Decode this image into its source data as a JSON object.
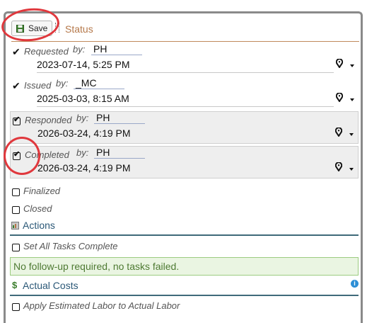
{
  "toolbar": {
    "save_label": "Save",
    "title": "Status"
  },
  "statuses": [
    {
      "label": "Requested",
      "by_label": "by:",
      "by_value": "PH",
      "datetime": "2023-07-14, 5:25 PM",
      "checked": true
    },
    {
      "label": "Issued",
      "by_label": "by:",
      "by_value": "_MC",
      "datetime": "2025-03-03, 8:15 AM",
      "checked": true
    },
    {
      "label": "Responded",
      "by_label": "by:",
      "by_value": "PH",
      "datetime": "2026-03-24, 4:19 PM",
      "checked": true
    },
    {
      "label": "Completed",
      "by_label": "by:",
      "by_value": "PH",
      "datetime": "2026-03-24, 4:19 PM",
      "checked": true
    }
  ],
  "finalized": {
    "label": "Finalized",
    "checked": false
  },
  "closed": {
    "label": "Closed",
    "checked": false
  },
  "actions": {
    "title": "Actions",
    "set_all_tasks": {
      "label": "Set All Tasks Complete",
      "checked": false
    },
    "notice": "No follow-up required, no tasks failed."
  },
  "actual_costs": {
    "title": "Actual Costs",
    "apply_estimated": {
      "label": "Apply Estimated Labor to Actual Labor",
      "checked": false
    }
  },
  "colors": {
    "accent": "#b5784a",
    "section": "#2b5877",
    "notice_bg": "#eaf5e2",
    "notice_text": "#4e7a33",
    "annotation": "#e0383d"
  },
  "icons": [
    "save-icon",
    "check-icon",
    "checkbox-icon",
    "map-pin-icon",
    "chevron-down-icon",
    "actions-icon",
    "dollar-icon",
    "info-icon"
  ]
}
